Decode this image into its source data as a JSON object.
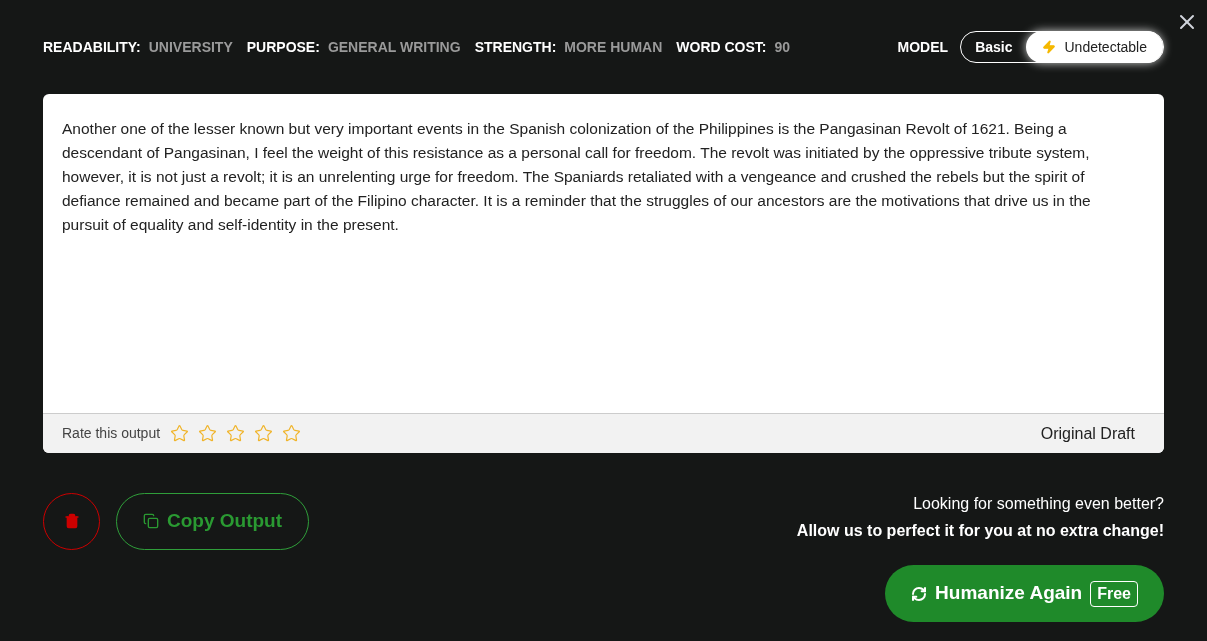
{
  "settings": [
    {
      "label": "READABILITY:",
      "value": "UNIVERSITY"
    },
    {
      "label": "PURPOSE:",
      "value": "GENERAL WRITING"
    },
    {
      "label": "STRENGTH:",
      "value": "MORE HUMAN"
    },
    {
      "label": "WORD COST:",
      "value": "90"
    }
  ],
  "model": {
    "label": "MODEL",
    "options": [
      {
        "label": "Basic",
        "selected": false,
        "kind": "plain"
      },
      {
        "label": "Undetectable",
        "selected": true,
        "kind": "bolt"
      }
    ]
  },
  "output": {
    "text": "Another one of the lesser known but very important events in the Spanish colonization of the Philippines is the Pangasinan Revolt of 1621. Being a descendant of Pangasinan, I feel the weight of this resistance as a personal call for freedom. The revolt was initiated by the oppressive tribute system, however, it is not just a revolt; it is an unrelenting urge for freedom. The Spaniards retaliated with a vengeance and crushed the rebels but the spirit of defiance remained and became part of the Filipino character. It is a reminder that the struggles of our ancestors are the motivations that drive us in the pursuit of equality and self-identity in the present.",
    "rate_label": "Rate this output",
    "stars": 0,
    "draft_link": "Original Draft"
  },
  "copy_button": "Copy Output",
  "promo": {
    "question": "Looking for something even better?",
    "offer": "Allow us to perfect it for you at no extra change!"
  },
  "humanize_button": {
    "label": "Humanize Again",
    "badge": "Free"
  }
}
